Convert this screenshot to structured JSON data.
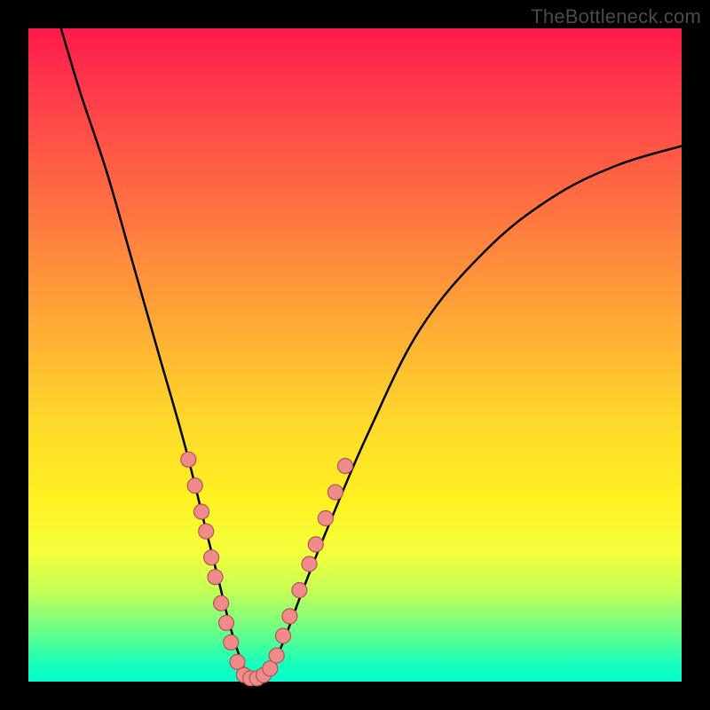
{
  "watermark": "TheBottleneck.com",
  "chart_data": {
    "type": "line",
    "title": "",
    "xlabel": "",
    "ylabel": "",
    "xlim": [
      0,
      100
    ],
    "ylim": [
      0,
      100
    ],
    "grid": false,
    "background": "rainbow-vertical-gradient",
    "series": [
      {
        "name": "bottleneck-curve",
        "x": [
          5,
          8,
          12,
          16,
          20,
          24,
          27,
          29,
          31,
          33,
          34,
          35,
          37,
          39,
          42,
          46,
          52,
          60,
          70,
          80,
          90,
          100
        ],
        "y": [
          100,
          90,
          78,
          64,
          50,
          36,
          24,
          16,
          8,
          2,
          0,
          0,
          2,
          6,
          14,
          24,
          38,
          54,
          66,
          74,
          79,
          82
        ]
      }
    ],
    "markers": {
      "name": "highlighted-points",
      "color": "#ef8b8b",
      "points": [
        {
          "x": 24.5,
          "y": 34
        },
        {
          "x": 25.5,
          "y": 30
        },
        {
          "x": 26.5,
          "y": 26
        },
        {
          "x": 27.2,
          "y": 23
        },
        {
          "x": 28.0,
          "y": 19
        },
        {
          "x": 28.6,
          "y": 16
        },
        {
          "x": 29.5,
          "y": 12
        },
        {
          "x": 30.3,
          "y": 9
        },
        {
          "x": 31.0,
          "y": 6
        },
        {
          "x": 32.0,
          "y": 3
        },
        {
          "x": 33.0,
          "y": 1
        },
        {
          "x": 34.0,
          "y": 0.5
        },
        {
          "x": 35.0,
          "y": 0.5
        },
        {
          "x": 36.0,
          "y": 1
        },
        {
          "x": 37.0,
          "y": 2
        },
        {
          "x": 38.0,
          "y": 4
        },
        {
          "x": 39.0,
          "y": 7
        },
        {
          "x": 40.0,
          "y": 10
        },
        {
          "x": 41.5,
          "y": 14
        },
        {
          "x": 43.0,
          "y": 18
        },
        {
          "x": 44.0,
          "y": 21
        },
        {
          "x": 45.5,
          "y": 25
        },
        {
          "x": 47.0,
          "y": 29
        },
        {
          "x": 48.5,
          "y": 33
        }
      ]
    }
  }
}
